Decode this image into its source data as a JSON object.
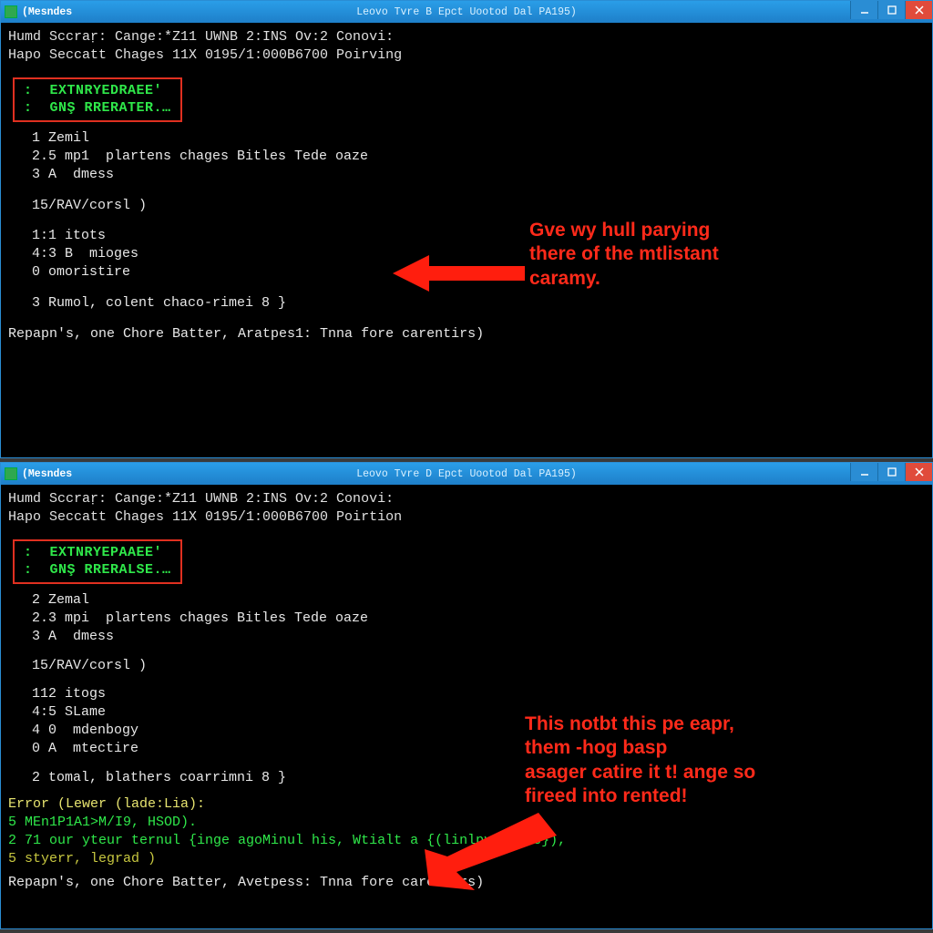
{
  "window_top": {
    "app_name": "(Mesndes",
    "title": "Leovo Tvre B Epct Uootod Dal PA195)",
    "header_line1": "Humd Sccraṛ: Cange:*Z11 UWNB 2:INS Ov:2 Conovi:",
    "header_line2": "Hapo Seccatt Chages 11X 0195/1:000B6700 Poirving",
    "box_line1": ":  EXTNRYEDRAEE'",
    "box_line2": ":  GNŞ RRERATER.…",
    "body1": "  1 Zemil",
    "body2": "  2.5 mp1  plartens chages Bitles Tede oaze",
    "body3": "  3 A  dmess",
    "body4": "  15/RAV/corsl )",
    "body5": "  1:1 itots",
    "body6": "  4:3 B  mioges",
    "body7": "  0 omoristire",
    "body8": "  3 Rumol, colent chaco-rimei 8 }",
    "prompt": "Repapn's, one Chore Batter, Aratpes1: Tnna fore carentirs)"
  },
  "window_bottom": {
    "app_name": "(Mesndes",
    "title": "Leovo Tvre D Epct Uootod Dal PA195)",
    "header_line1": "Humd Sccraṛ: Cange:*Z11 UWNB 2:INS Ov:2 Conovi:",
    "header_line2": "Hapo Seccatt Chages 11X 0195/1:000B6700 Poirtion",
    "box_line1": ":  EXTNRYEPAAEE'",
    "box_line2": ":  GNŞ RRERALSE.…",
    "body1": "  2 Zemal",
    "body2": "  2.3 mpi  plartens chages Bitles Tede oaze",
    "body3": "  3 A  dmess",
    "body4": "  15/RAV/corsl )",
    "body5": "  112 itogs",
    "body6": "  4:5 SLame",
    "body7": "  4 0  mdenbogy",
    "body8": "  0 A  mtectire",
    "body9": "  2 tomal, blathers coarrimni 8 }",
    "err_head": "Error (Lewer (lade:Lia):",
    "err1": "5 MEn1P1A1>M/I9, HSOD).",
    "err2": "2 71 our yteur ternul {inge agoMinul his, Wtialt a {(linlpv=stals}),",
    "err3": "5 styerr, legrad )",
    "prompt": "Repapn's, one Chore Batter, Avetpess: Tnna fore carentirs)"
  },
  "annotation_top": "Gve wy hull parying\nthere of the mtlistant\ncaramy.",
  "annotation_bottom": "This notbt this pe eapr,\nthem -hog basp\nasager catire it t! ange so\nfireed into rented!"
}
